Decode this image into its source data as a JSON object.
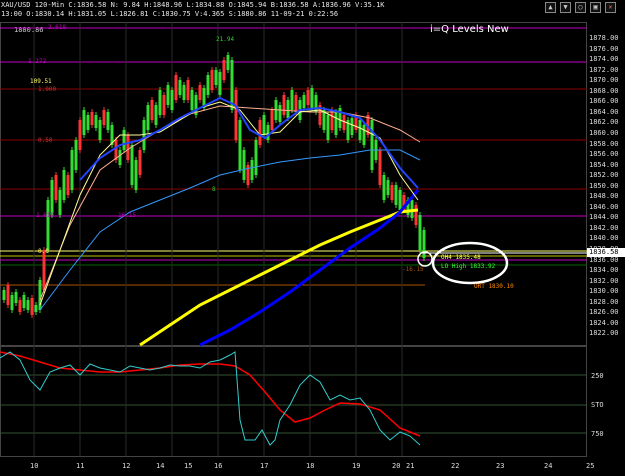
{
  "header": {
    "line1": "XAU/USD 120-Min  C:1836.58  N: 9.84  H:1848.96  L:1834.88  O:1845.94  B:1836.58  A:1836.96  V:35.1K",
    "line2": "13:00  O:1830.14  H:1831.05  L:1826.81  C:1830.75  V:4.365  S:1880.86  11-09-21  0:22:56",
    "line3": "1880.86"
  },
  "window_controls": [
    "▲",
    "▼",
    "○",
    "▣",
    "✕"
  ],
  "chart_title": "i=Q Levels New",
  "price_axis": [
    "1878.00",
    "1876.00",
    "1874.00",
    "1872.00",
    "1870.00",
    "1868.00",
    "1866.00",
    "1864.00",
    "1862.00",
    "1860.00",
    "1858.00",
    "1856.00",
    "1854.00",
    "1852.00",
    "1850.00",
    "1848.00",
    "1846.00",
    "1844.00",
    "1842.00",
    "1840.00",
    "1838.00",
    "1836.00",
    "1834.00",
    "1832.00",
    "1830.00",
    "1828.00",
    "1826.00",
    "1824.00",
    "1822.00"
  ],
  "current_price_tag": "1836.58",
  "level_labels": {
    "top": "2.618",
    "l1272": "1.272",
    "l109": "109.51",
    "l100": "1.000",
    "l50": "0.50",
    "l618": "1.618",
    "l0": "0.0",
    "peak": "21.94",
    "mid": "8",
    "l2": "16.15",
    "l3": "-16.15"
  },
  "annotations": {
    "oh4": "OH4  1835.48",
    "lohigh": "LO High  1833.92",
    "ort": "ORT  1830.10"
  },
  "indicator_axis": [
    "250",
    "STO",
    "750"
  ],
  "date_labels": [
    "10",
    "11",
    "12",
    "14",
    "15",
    "16",
    "17",
    "18",
    "19",
    "20",
    "21",
    "22",
    "23",
    "24",
    "25"
  ]
}
